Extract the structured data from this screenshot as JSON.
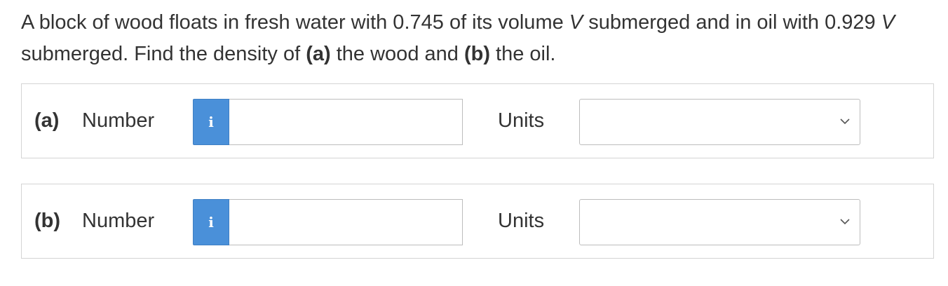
{
  "question": {
    "text_1": "A block of wood floats in fresh water with 0.745 of its volume ",
    "var_1": "V",
    "text_2": " submerged and in oil with 0.929 ",
    "var_2": "V",
    "text_3": " submerged. Find the density of ",
    "part_a_ref": "(a)",
    "text_4": " the wood and ",
    "part_b_ref": "(b)",
    "text_5": " the oil."
  },
  "parts": [
    {
      "letter": "(a)",
      "number_label": "Number",
      "info_icon": "i",
      "number_value": "",
      "units_label": "Units",
      "units_selected": ""
    },
    {
      "letter": "(b)",
      "number_label": "Number",
      "info_icon": "i",
      "number_value": "",
      "units_label": "Units",
      "units_selected": ""
    }
  ],
  "colors": {
    "info_button": "#4a90d9",
    "text": "#333333",
    "border": "#d4d4d4"
  },
  "icons": {
    "info": "info-icon",
    "dropdown": "chevron-down-icon"
  }
}
